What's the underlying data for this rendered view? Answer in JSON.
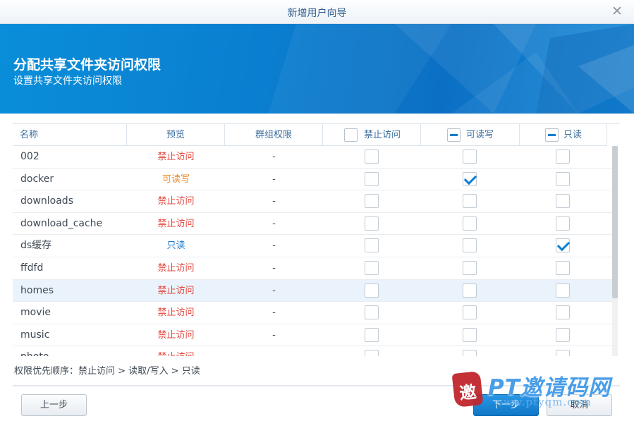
{
  "window": {
    "title": "新增用户向导"
  },
  "banner": {
    "heading": "分配共享文件夹访问权限",
    "subheading": "设置共享文件夹访问权限"
  },
  "colors": {
    "deny": "#e2453c",
    "read_write": "#f08a24",
    "read_only": "#1a7fd0",
    "accent": "#0d7fd0"
  },
  "table": {
    "headers": {
      "name": "名称",
      "preview": "预览",
      "group": "群组权限",
      "deny": "禁止访问",
      "read_write": "可读写",
      "read_only": "只读"
    },
    "header_boxes": {
      "deny": "unchecked",
      "read_write": "partial",
      "read_only": "partial"
    },
    "rows": [
      {
        "name": "002",
        "preview": "禁止访问",
        "preview_type": "deny",
        "group": "-",
        "deny": false,
        "read_write": false,
        "read_only": false
      },
      {
        "name": "docker",
        "preview": "可读写",
        "preview_type": "read_write",
        "group": "-",
        "deny": false,
        "read_write": true,
        "read_only": false
      },
      {
        "name": "downloads",
        "preview": "禁止访问",
        "preview_type": "deny",
        "group": "-",
        "deny": false,
        "read_write": false,
        "read_only": false
      },
      {
        "name": "download_cache",
        "preview": "禁止访问",
        "preview_type": "deny",
        "group": "-",
        "deny": false,
        "read_write": false,
        "read_only": false
      },
      {
        "name": "ds缓存",
        "preview": "只读",
        "preview_type": "read_only",
        "group": "-",
        "deny": false,
        "read_write": false,
        "read_only": true
      },
      {
        "name": "ffdfd",
        "preview": "禁止访问",
        "preview_type": "deny",
        "group": "-",
        "deny": false,
        "read_write": false,
        "read_only": false
      },
      {
        "name": "homes",
        "preview": "禁止访问",
        "preview_type": "deny",
        "group": "-",
        "deny": false,
        "read_write": false,
        "read_only": false,
        "highlighted": true
      },
      {
        "name": "movie",
        "preview": "禁止访问",
        "preview_type": "deny",
        "group": "-",
        "deny": false,
        "read_write": false,
        "read_only": false
      },
      {
        "name": "music",
        "preview": "禁止访问",
        "preview_type": "deny",
        "group": "-",
        "deny": false,
        "read_write": false,
        "read_only": false
      },
      {
        "name": "photo",
        "preview": "禁止访问",
        "preview_type": "deny",
        "group": "-",
        "deny": false,
        "read_write": false,
        "read_only": false
      }
    ]
  },
  "footnote": "权限优先顺序：禁止访问 > 读取/写入 > 只读",
  "buttons": {
    "prev": "上一步",
    "next": "下一步",
    "cancel": "取消"
  },
  "watermark": {
    "stamp": "邀",
    "logo": "PT邀请码网",
    "url": "www.ptyqm.com"
  },
  "icons": {
    "close": "close-icon"
  }
}
